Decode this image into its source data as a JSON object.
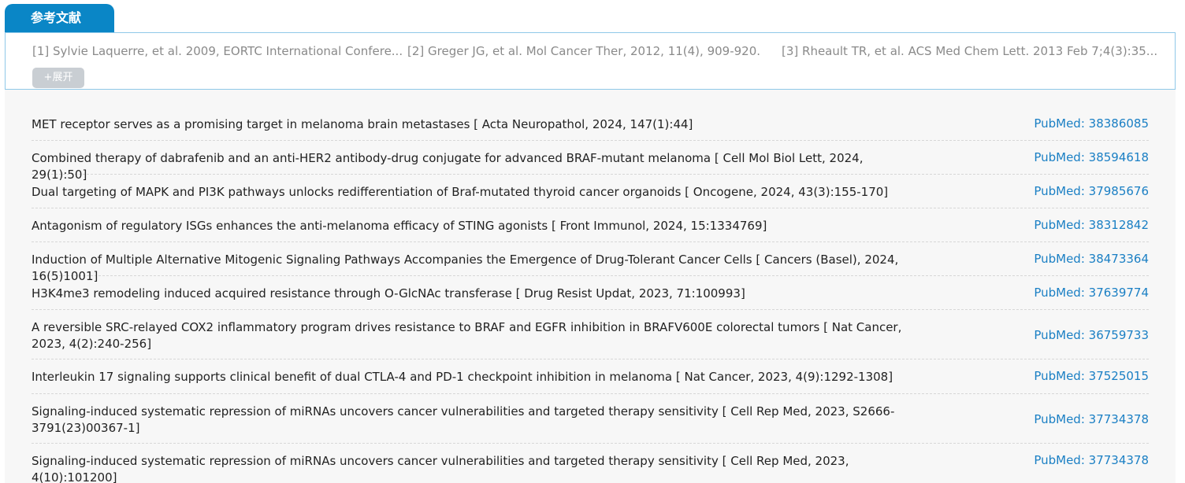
{
  "section": {
    "tab_title": "参考文献",
    "expand_label": "+展开"
  },
  "references": [
    "[1] Sylvie Laquerre, et al. 2009, EORTC International Confere...",
    "[2] Greger JG, et al. Mol Cancer Ther, 2012, 11(4), 909-920.",
    "[3] Rheault TR, et al. ACS Med Chem Lett. 2013 Feb 7;4(3):35..."
  ],
  "citations": [
    {
      "title": "MET receptor serves as a promising target in melanoma brain metastases [ Acta Neuropathol, 2024, 147(1):44]",
      "pubmed": "PubMed: 38386085"
    },
    {
      "title": "Combined therapy of dabrafenib and an anti-HER2 antibody-drug conjugate for advanced BRAF-mutant melanoma [ Cell Mol Biol Lett, 2024, 29(1):50]",
      "pubmed": "PubMed: 38594618"
    },
    {
      "title": "Dual targeting of MAPK and PI3K pathways unlocks redifferentiation of Braf-mutated thyroid cancer organoids [ Oncogene, 2024, 43(3):155-170]",
      "pubmed": "PubMed: 37985676"
    },
    {
      "title": "Antagonism of regulatory ISGs enhances the anti-melanoma efficacy of STING agonists [ Front Immunol, 2024, 15:1334769]",
      "pubmed": "PubMed: 38312842"
    },
    {
      "title": "Induction of Multiple Alternative Mitogenic Signaling Pathways Accompanies the Emergence of Drug-Tolerant Cancer Cells [ Cancers (Basel), 2024, 16(5)1001]",
      "pubmed": "PubMed: 38473364"
    },
    {
      "title": "H3K4me3 remodeling induced acquired resistance through O-GlcNAc transferase [ Drug Resist Updat, 2023, 71:100993]",
      "pubmed": "PubMed: 37639774"
    },
    {
      "title": "A reversible SRC-relayed COX2 inflammatory program drives resistance to BRAF and EGFR inhibition in BRAFV600E colorectal tumors [ Nat Cancer, 2023, 4(2):240-256]",
      "pubmed": "PubMed: 36759733"
    },
    {
      "title": "Interleukin 17 signaling supports clinical benefit of dual CTLA-4 and PD-1 checkpoint inhibition in melanoma [ Nat Cancer, 2023, 4(9):1292-1308]",
      "pubmed": "PubMed: 37525015"
    },
    {
      "title": "Signaling-induced systematic repression of miRNAs uncovers cancer vulnerabilities and targeted therapy sensitivity [ Cell Rep Med, 2023, S2666-3791(23)00367-1]",
      "pubmed": "PubMed: 37734378"
    },
    {
      "title": "Signaling-induced systematic repression of miRNAs uncovers cancer vulnerabilities and targeted therapy sensitivity [ Cell Rep Med, 2023, 4(10):101200]",
      "pubmed": "PubMed: 37734378"
    }
  ]
}
